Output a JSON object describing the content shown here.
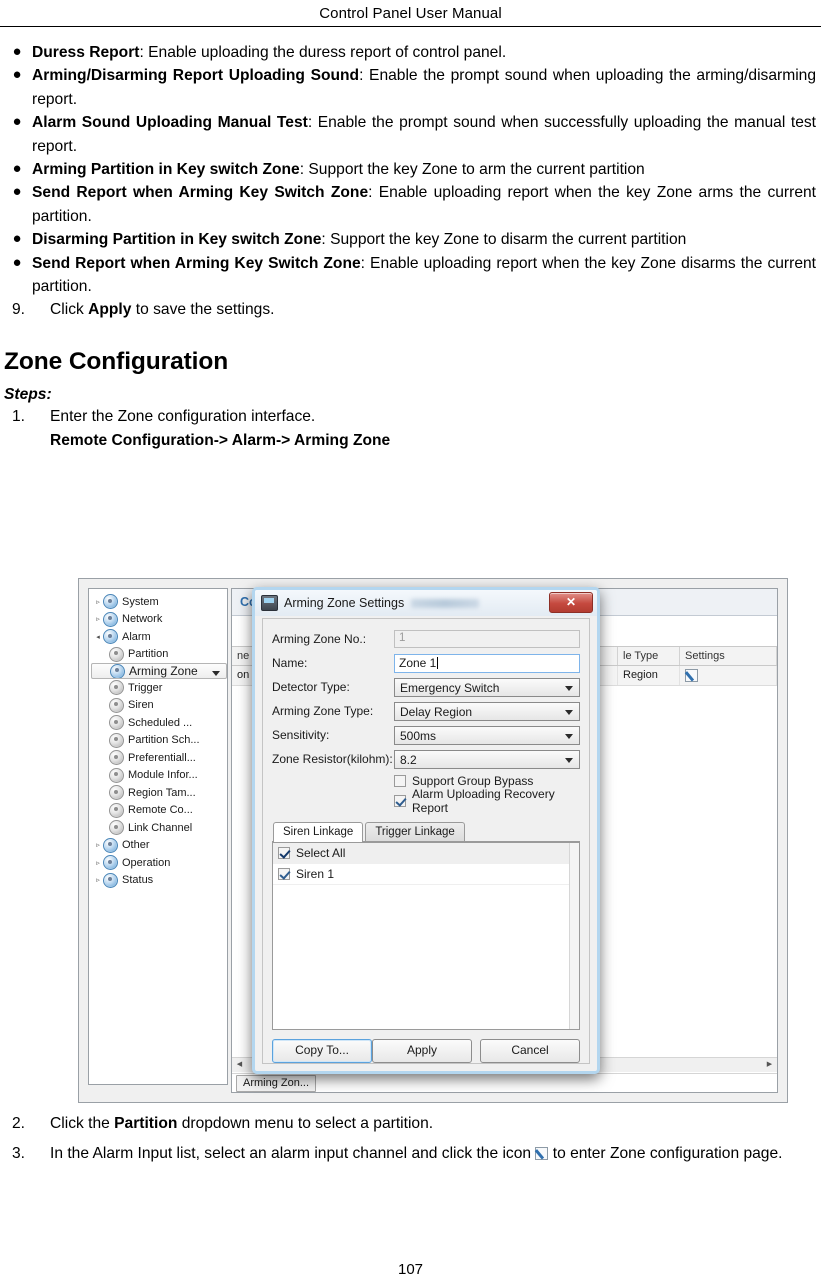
{
  "header": {
    "running_title": "Control Panel User Manual"
  },
  "page_number": "107",
  "bullets": [
    {
      "term": "Duress Report",
      "rest": ": Enable uploading the duress report of control panel."
    },
    {
      "term": "Arming/Disarming Report Uploading Sound",
      "rest": ": Enable the prompt sound when uploading the arming/disarming report."
    },
    {
      "term": "Alarm Sound Uploading Manual Test",
      "rest": ": Enable the prompt sound when successfully uploading the manual test report."
    },
    {
      "term": "Arming Partition in Key switch Zone",
      "rest": ": Support the key Zone to arm the current partition"
    },
    {
      "term": "Send Report when Arming Key Switch Zone",
      "rest": ": Enable uploading report when the key Zone arms the current partition."
    },
    {
      "term": "Disarming Partition in Key switch Zone",
      "rest": ": Support the key Zone to disarm the current partition"
    },
    {
      "term": "Send Report when Arming Key Switch Zone",
      "rest": ": Enable uploading report when the key Zone disarms the current partition."
    }
  ],
  "step9": {
    "num": "9.",
    "pre": "Click ",
    "bold": "Apply",
    "post": " to save the settings."
  },
  "section": {
    "title": "Zone Configuration",
    "steps_label": "Steps:"
  },
  "step1": {
    "num": "1.",
    "text": "Enter the Zone configuration interface.",
    "path": "Remote Configuration-> Alarm-> Arming Zone"
  },
  "step2": {
    "num": "2.",
    "pre": "Click the ",
    "bold": "Partition",
    "post": " dropdown menu to select a partition."
  },
  "step3": {
    "num": "3.",
    "pre": "In the Alarm Input list, select an alarm input channel and click the icon ",
    "post": " to enter Zone configuration page."
  },
  "screenshot": {
    "tree": {
      "items": [
        {
          "label": "System",
          "level": 0,
          "arrow": "▹",
          "icon": "gear-blue-icon",
          "selected": false
        },
        {
          "label": "Network",
          "level": 0,
          "arrow": "▹",
          "icon": "gear-blue-icon",
          "selected": false
        },
        {
          "label": "Alarm",
          "level": 0,
          "arrow": "◂",
          "icon": "gear-blue-icon",
          "selected": false
        },
        {
          "label": "Partition",
          "level": 1,
          "arrow": "",
          "icon": "gear-grey-icon",
          "selected": false
        },
        {
          "label": "Arming Zone",
          "level": 1,
          "arrow": "",
          "icon": "gear-blue-icon",
          "selected": true
        },
        {
          "label": "Trigger",
          "level": 1,
          "arrow": "",
          "icon": "gear-grey-icon",
          "selected": false
        },
        {
          "label": "Siren",
          "level": 1,
          "arrow": "",
          "icon": "gear-grey-icon",
          "selected": false
        },
        {
          "label": "Scheduled ...",
          "level": 1,
          "arrow": "",
          "icon": "gear-grey-icon",
          "selected": false
        },
        {
          "label": "Partition Sch...",
          "level": 1,
          "arrow": "",
          "icon": "gear-grey-icon",
          "selected": false
        },
        {
          "label": "Preferentiall...",
          "level": 1,
          "arrow": "",
          "icon": "gear-grey-icon",
          "selected": false
        },
        {
          "label": "Module Infor...",
          "level": 1,
          "arrow": "",
          "icon": "gear-grey-icon",
          "selected": false
        },
        {
          "label": "Region Tam...",
          "level": 1,
          "arrow": "",
          "icon": "gear-grey-icon",
          "selected": false
        },
        {
          "label": "Remote Co...",
          "level": 1,
          "arrow": "",
          "icon": "gear-grey-icon",
          "selected": false
        },
        {
          "label": "Link Channel",
          "level": 1,
          "arrow": "",
          "icon": "gear-grey-icon",
          "selected": false
        },
        {
          "label": "Other",
          "level": 0,
          "arrow": "▹",
          "icon": "gear-blue-icon",
          "selected": false
        },
        {
          "label": "Operation",
          "level": 0,
          "arrow": "▹",
          "icon": "gear-blue-icon",
          "selected": false
        },
        {
          "label": "Status",
          "level": 0,
          "arrow": "▹",
          "icon": "gear-blue-icon",
          "selected": false
        }
      ]
    },
    "panel": {
      "title": "Con",
      "grid_headers": [
        "ne T...",
        "",
        "",
        "le Type",
        "Settings"
      ],
      "grid_row": [
        "on",
        "",
        "",
        "Region",
        ""
      ],
      "bottom_tab": "Arming Zon...",
      "scroll_left_arrow": "◀",
      "scroll_right_arrow": "▶"
    },
    "dialog": {
      "title": "Arming Zone Settings",
      "close_label": "✕",
      "fields": [
        {
          "label": "Arming Zone No.:",
          "value": "1",
          "type": "readonly"
        },
        {
          "label": "Name:",
          "value": "Zone 1",
          "type": "text"
        },
        {
          "label": "Detector Type:",
          "value": "Emergency Switch",
          "type": "select"
        },
        {
          "label": "Arming Zone Type:",
          "value": "Delay Region",
          "type": "select"
        },
        {
          "label": "Sensitivity:",
          "value": "500ms",
          "type": "select"
        },
        {
          "label": "Zone Resistor(kilohm):",
          "value": "8.2",
          "type": "select"
        }
      ],
      "checkboxes": [
        {
          "label": "Support Group Bypass",
          "checked": false
        },
        {
          "label": "Alarm Uploading Recovery Report",
          "checked": true
        }
      ],
      "tabs": [
        {
          "label": "Siren Linkage",
          "active": true
        },
        {
          "label": "Trigger Linkage",
          "active": false
        }
      ],
      "list": [
        {
          "label": "Select All",
          "checked": true,
          "header": true
        },
        {
          "label": "Siren 1",
          "checked": true,
          "header": false
        }
      ],
      "buttons": {
        "copy_to": "Copy To...",
        "apply": "Apply",
        "cancel": "Cancel"
      }
    }
  }
}
